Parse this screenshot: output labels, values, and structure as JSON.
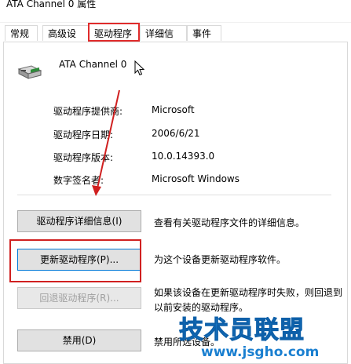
{
  "window": {
    "title": "ATA Channel 0 属性"
  },
  "tabs": [
    {
      "label": "常规",
      "selected": false
    },
    {
      "label": "高级设置",
      "selected": false
    },
    {
      "label": "驱动程序",
      "selected": true
    },
    {
      "label": "详细信息",
      "selected": false
    },
    {
      "label": "事件",
      "selected": false
    }
  ],
  "device": {
    "name": "ATA Channel 0",
    "icon": "controller-card-icon"
  },
  "info": {
    "provider": {
      "label": "驱动程序提供商:",
      "value": "Microsoft"
    },
    "date": {
      "label": "驱动程序日期:",
      "value": "2006/6/21"
    },
    "version": {
      "label": "驱动程序版本:",
      "value": "10.0.14393.0"
    },
    "signer": {
      "label": "数字签名者:",
      "value": "Microsoft Windows"
    }
  },
  "actions": [
    {
      "label": "驱动程序详细信息(I)",
      "description": "查看有关驱动程序文件的详细信息。",
      "enabled": true
    },
    {
      "label": "更新驱动程序(P)...",
      "description": "为这个设备更新驱动程序软件。",
      "enabled": true,
      "focused": true
    },
    {
      "label": "回退驱动程序(R)...",
      "description": "如果该设备在更新驱动程序时失败，则回退到以前安装的驱动程序。",
      "enabled": false
    },
    {
      "label": "禁用(D)",
      "description": "禁用所选设备。",
      "enabled": true
    }
  ],
  "watermark": {
    "text": "技术员联盟",
    "url": "www.jsgho.com"
  },
  "colors": {
    "highlight": "#d02020",
    "focus": "#0078d7",
    "watermark": "#1a7fd0"
  }
}
